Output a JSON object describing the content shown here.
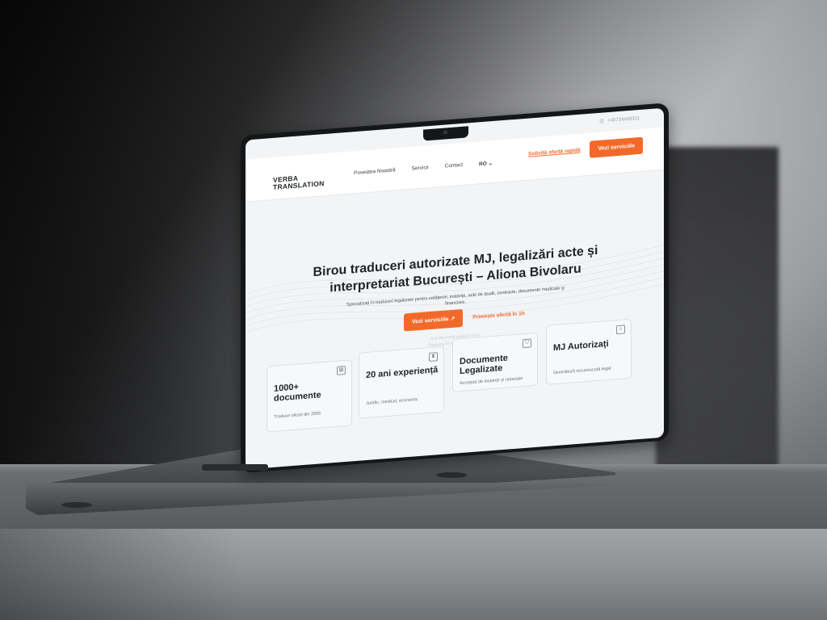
{
  "site": {
    "topbar": {
      "phone": "+40734468311"
    },
    "logo": {
      "line1": "VERBA",
      "line2": "TRANSLATION"
    },
    "nav": {
      "items": [
        "Povestea Noastră",
        "Servicii",
        "Contact"
      ],
      "language": "RO"
    },
    "header_cta": {
      "quick_offer": "Solicită ofertă rapidă",
      "view_services": "Vezi serviciile"
    },
    "hero": {
      "title": "Birou traduceri autorizate MJ, legalizări acte și interpretariat București – Aliona Bivolaru",
      "subtitle": "Specializați în traduceri legalizate pentru cetățenie, instanțe, acte de studii, contracte, documente medicale și financiare.",
      "primary_button": "Vezi serviciile",
      "secondary_link": "Primește ofertă în 1h",
      "faded_line1": "Solicită ofertă gratuită acum",
      "faded_line2": "Răspuns în mai puțin de o oră"
    },
    "cards": [
      {
        "title": "1000+ documente",
        "desc": "Traduse oficial din 2005",
        "icon": "document-icon"
      },
      {
        "title": "20 ani experiență",
        "desc": "Juridic, medical, economic",
        "icon": "hourglass-icon"
      },
      {
        "title": "Documente Legalizate",
        "desc": "Acceptat de instanțe și notariate",
        "icon": "shield-icon"
      },
      {
        "title": "MJ Autorizați",
        "desc": "Semnătură recunoscută legal",
        "icon": "bank-icon"
      }
    ],
    "colors": {
      "accent": "#f26a2a",
      "text": "#1f2429",
      "background": "#f3f4f6"
    }
  }
}
